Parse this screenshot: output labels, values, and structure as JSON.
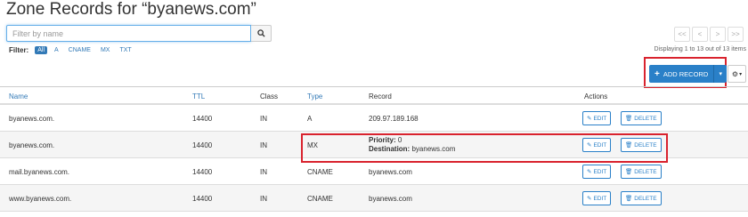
{
  "title": "Zone Records for “byanews.com”",
  "search": {
    "placeholder": "Filter by name"
  },
  "filters": {
    "label": "Filter:",
    "options": [
      "All",
      "A",
      "CNAME",
      "MX",
      "TXT"
    ],
    "active": "All"
  },
  "pager": {
    "first": "<<",
    "prev": "<",
    "next": ">",
    "last": ">>"
  },
  "display_info": "Displaying 1 to 13 out of 13 items",
  "toolbar": {
    "add_record": "ADD RECORD"
  },
  "table": {
    "headers": {
      "name": "Name",
      "ttl": "TTL",
      "class": "Class",
      "type": "Type",
      "record": "Record",
      "actions": "Actions"
    },
    "rows": [
      {
        "name": "byanews.com.",
        "ttl": "14400",
        "class": "IN",
        "type": "A",
        "record": "209.97.189.168"
      },
      {
        "name": "byanews.com.",
        "ttl": "14400",
        "class": "IN",
        "type": "MX",
        "priority_label": "Priority:",
        "priority": "0",
        "destination_label": "Destination:",
        "destination": "byanews.com"
      },
      {
        "name": "mail.byanews.com.",
        "ttl": "14400",
        "class": "IN",
        "type": "CNAME",
        "record": "byanews.com"
      },
      {
        "name": "www.byanews.com.",
        "ttl": "14400",
        "class": "IN",
        "type": "CNAME",
        "record": "byanews.com"
      }
    ],
    "edit_label": "EDIT",
    "delete_label": "DELETE"
  },
  "colors": {
    "accent": "#2a80c8",
    "highlight": "#d9232e",
    "link": "#337ab7"
  },
  "icons": {
    "search": "search-icon",
    "edit": "pencil-icon",
    "delete": "trash-icon",
    "add": "plus-icon",
    "settings": "gear-icon"
  }
}
